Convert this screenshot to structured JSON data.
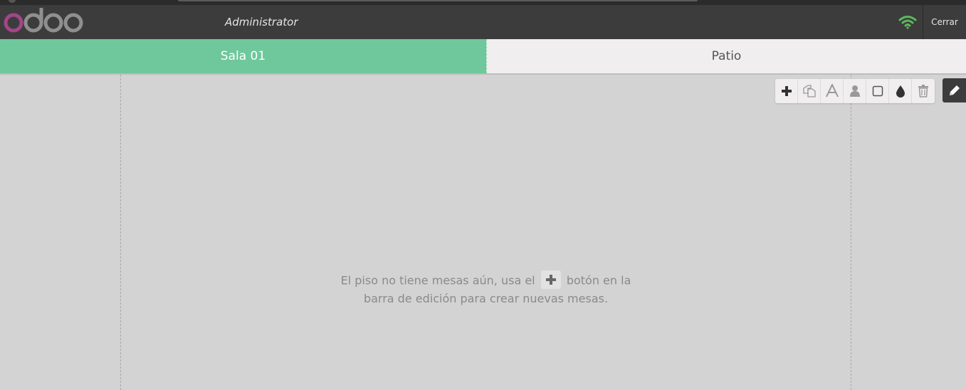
{
  "header": {
    "logo_text": "odoo",
    "cashier": "Administrator",
    "close_label": "Cerrar",
    "connection_icon": "wifi-icon",
    "connection_color": "#5cb85c"
  },
  "floors": {
    "tabs": [
      {
        "label": "Sala 01",
        "active": true
      },
      {
        "label": "Patio",
        "active": false
      }
    ],
    "active_color": "#6ec89b"
  },
  "edit_toolbar": {
    "tools": [
      "plus-icon",
      "copy-icon",
      "text-icon",
      "seats-icon",
      "shape-square-icon",
      "color-drop-icon",
      "trash-icon"
    ],
    "toggle_icon": "pencil-icon"
  },
  "empty_message": {
    "before": "El piso no tiene mesas aún, usa el",
    "after": "botón en la",
    "line2": "barra de edición para crear nuevas mesas."
  }
}
